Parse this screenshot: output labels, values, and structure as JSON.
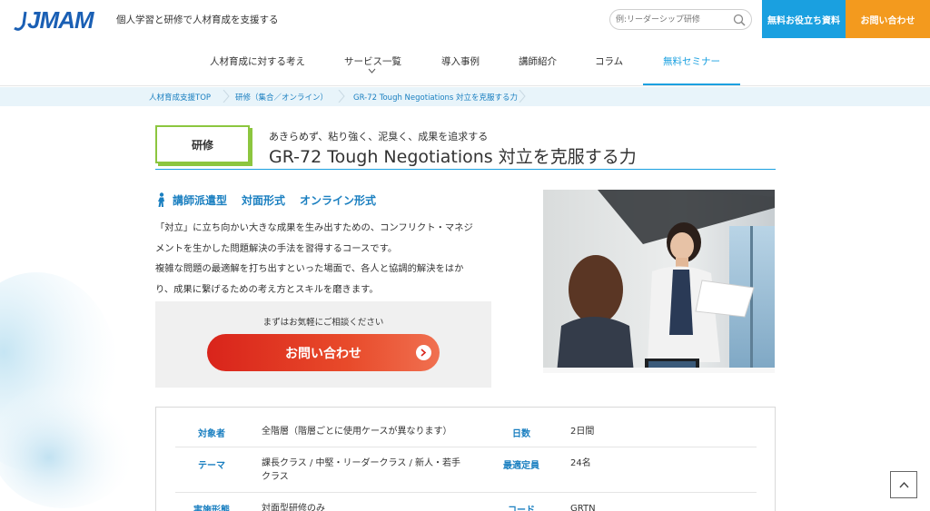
{
  "header": {
    "logo_text": "JMAM",
    "tagline": "個人学習と研修で人材育成を支援する",
    "search_placeholder": "例:リーダーシップ研修",
    "btn_resources": "無料お役立ち資料",
    "btn_contact": "お問い合わせ"
  },
  "nav": {
    "items": [
      {
        "label": "人材育成に対する考え"
      },
      {
        "label": "サービス一覧"
      },
      {
        "label": "導入事例"
      },
      {
        "label": "講師紹介"
      },
      {
        "label": "コラム"
      },
      {
        "label": "無料セミナー"
      }
    ],
    "active_index": 5
  },
  "breadcrumb": {
    "items": [
      "人材育成支援TOP",
      "研修（集合／オンライン）",
      "GR-72 Tough Negotiations 対立を克服する力"
    ]
  },
  "course": {
    "badge": "研修",
    "subtitle": "あきらめず、粘り強く、泥臭く、成果を追求する",
    "title": "GR-72 Tough Negotiations 対立を克服する力",
    "formats": [
      "講師派遣型",
      "対面形式",
      "オンライン形式"
    ],
    "description": [
      "「対立」に立ち向かい大きな成果を生み出すための、コンフリクト・マネジ",
      "メントを生かした問題解決の手法を習得するコースです。",
      "複雑な問題の最適解を打ち出すといった場面で、各人と協調的解決をはか",
      "り、成果に繋げるための考え方とスキルを磨きます。"
    ],
    "cta_note": "まずはお気軽にご相談ください",
    "cta_button": "お問い合わせ"
  },
  "info": {
    "rows": [
      {
        "label_left": "対象者",
        "value_left": "全階層（階層ごとに使用ケースが異なります）",
        "label_right": "日数",
        "value_right": "2日間"
      },
      {
        "label_left": "テーマ",
        "value_left_lines": [
          "課長クラス / 中堅・リーダークラス / 新人・若手",
          "クラス"
        ],
        "label_right": "最適定員",
        "value_right": "24名"
      },
      {
        "label_left": "実施形態",
        "value_left": "対面型研修のみ",
        "label_right": "コード",
        "value_right": "GRTN"
      }
    ]
  },
  "colors": {
    "brand_blue": "#1aa0e0",
    "link_blue": "#1a7fc0",
    "orange": "#f39a1e",
    "badge_green": "#8cc63f",
    "cta_red": "#d9241b"
  }
}
